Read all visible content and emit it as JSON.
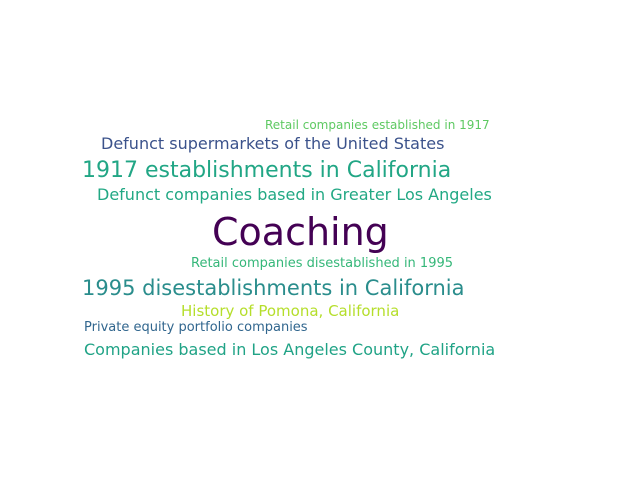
{
  "word_cloud": {
    "words": [
      {
        "text": "Retail companies established in 1917",
        "color": "#5ec962"
      },
      {
        "text": "Defunct supermarkets of the United States",
        "color": "#3b528b"
      },
      {
        "text": "1917 establishments in California",
        "color": "#21a685"
      },
      {
        "text": "Defunct companies based in Greater Los Angeles",
        "color": "#22a884"
      },
      {
        "text": "Coaching",
        "color": "#440154"
      },
      {
        "text": "Retail companies disestablished in 1995",
        "color": "#35b779"
      },
      {
        "text": "1995 disestablishments in California",
        "color": "#2a8d8c"
      },
      {
        "text": "History of Pomona, California",
        "color": "#b5de2b"
      },
      {
        "text": "Private equity portfolio companies",
        "color": "#31668e"
      },
      {
        "text": "Companies based in Los Angeles County, California",
        "color": "#20a386"
      }
    ]
  }
}
